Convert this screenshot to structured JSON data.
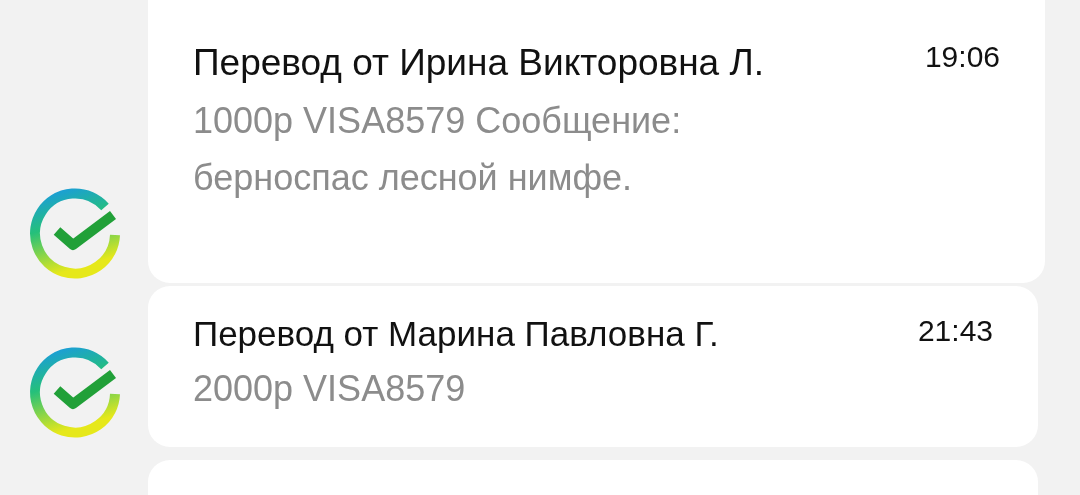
{
  "messages": [
    {
      "title": "Перевод от Ирина Викторовна Л.",
      "time": "19:06",
      "text": "1000р VISA8579 Сообщение: берноспас лесной нимфе."
    },
    {
      "title": "Перевод от Марина Павловна Г.",
      "time": "21:43",
      "text": "2000р VISA8579"
    }
  ]
}
